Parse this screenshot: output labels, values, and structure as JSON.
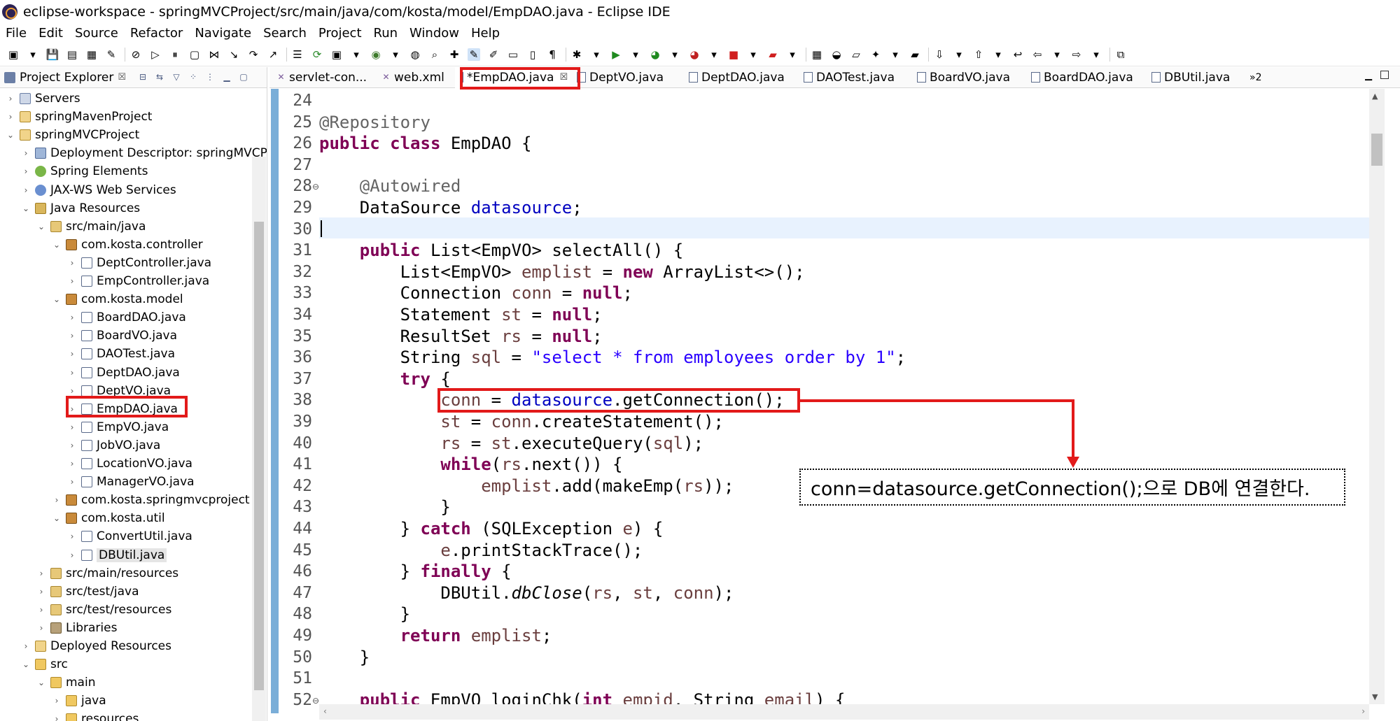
{
  "window": {
    "title": "eclipse-workspace - springMVCProject/src/main/java/com/kosta/model/EmpDAO.java - Eclipse IDE"
  },
  "menubar": [
    "File",
    "Edit",
    "Source",
    "Refactor",
    "Navigate",
    "Search",
    "Project",
    "Run",
    "Window",
    "Help"
  ],
  "explorer": {
    "title": "Project Explorer",
    "close": "☒",
    "tree": [
      {
        "label": "Servers",
        "depth": 0,
        "twisty": "›",
        "icon": "server"
      },
      {
        "label": "springMavenProject",
        "depth": 0,
        "twisty": "›",
        "icon": "proj"
      },
      {
        "label": "springMVCProject",
        "depth": 0,
        "twisty": "⌄",
        "icon": "proj"
      },
      {
        "label": "Deployment Descriptor: springMVCP",
        "depth": 1,
        "twisty": "›",
        "icon": "dd"
      },
      {
        "label": "Spring Elements",
        "depth": 1,
        "twisty": "›",
        "icon": "spring"
      },
      {
        "label": "JAX-WS Web Services",
        "depth": 1,
        "twisty": "›",
        "icon": "ws"
      },
      {
        "label": "Java Resources",
        "depth": 1,
        "twisty": "⌄",
        "icon": "jr"
      },
      {
        "label": "src/main/java",
        "depth": 2,
        "twisty": "⌄",
        "icon": "src"
      },
      {
        "label": "com.kosta.controller",
        "depth": 3,
        "twisty": "⌄",
        "icon": "pkg"
      },
      {
        "label": "DeptController.java",
        "depth": 4,
        "twisty": "›",
        "icon": "java"
      },
      {
        "label": "EmpController.java",
        "depth": 4,
        "twisty": "›",
        "icon": "java"
      },
      {
        "label": "com.kosta.model",
        "depth": 3,
        "twisty": "⌄",
        "icon": "pkg"
      },
      {
        "label": "BoardDAO.java",
        "depth": 4,
        "twisty": "›",
        "icon": "java"
      },
      {
        "label": "BoardVO.java",
        "depth": 4,
        "twisty": "›",
        "icon": "java"
      },
      {
        "label": "DAOTest.java",
        "depth": 4,
        "twisty": "›",
        "icon": "java"
      },
      {
        "label": "DeptDAO.java",
        "depth": 4,
        "twisty": "›",
        "icon": "java"
      },
      {
        "label": "DeptVO.java",
        "depth": 4,
        "twisty": "›",
        "icon": "java"
      },
      {
        "label": "EmpDAO.java",
        "depth": 4,
        "twisty": "›",
        "icon": "java"
      },
      {
        "label": "EmpVO.java",
        "depth": 4,
        "twisty": "›",
        "icon": "java"
      },
      {
        "label": "JobVO.java",
        "depth": 4,
        "twisty": "›",
        "icon": "java"
      },
      {
        "label": "LocationVO.java",
        "depth": 4,
        "twisty": "›",
        "icon": "java"
      },
      {
        "label": "ManagerVO.java",
        "depth": 4,
        "twisty": "›",
        "icon": "java"
      },
      {
        "label": "com.kosta.springmvcproject",
        "depth": 3,
        "twisty": "›",
        "icon": "pkg"
      },
      {
        "label": "com.kosta.util",
        "depth": 3,
        "twisty": "⌄",
        "icon": "pkg"
      },
      {
        "label": "ConvertUtil.java",
        "depth": 4,
        "twisty": "›",
        "icon": "java"
      },
      {
        "label": "DBUtil.java",
        "depth": 4,
        "twisty": "›",
        "icon": "java",
        "selected": true
      },
      {
        "label": "src/main/resources",
        "depth": 2,
        "twisty": "›",
        "icon": "src"
      },
      {
        "label": "src/test/java",
        "depth": 2,
        "twisty": "›",
        "icon": "src"
      },
      {
        "label": "src/test/resources",
        "depth": 2,
        "twisty": "›",
        "icon": "src"
      },
      {
        "label": "Libraries",
        "depth": 2,
        "twisty": "›",
        "icon": "lib"
      },
      {
        "label": "Deployed Resources",
        "depth": 1,
        "twisty": "›",
        "icon": "proj"
      },
      {
        "label": "src",
        "depth": 1,
        "twisty": "⌄",
        "icon": "folder"
      },
      {
        "label": "main",
        "depth": 2,
        "twisty": "⌄",
        "icon": "folder"
      },
      {
        "label": "java",
        "depth": 3,
        "twisty": "›",
        "icon": "folder"
      },
      {
        "label": "resources",
        "depth": 3,
        "twisty": "›",
        "icon": "folder"
      }
    ]
  },
  "tabs": [
    {
      "label": "servlet-con...",
      "icon": "xml"
    },
    {
      "label": "web.xml",
      "icon": "xml"
    },
    {
      "label": "*EmpDAO.java",
      "icon": "java",
      "active": true,
      "close": "☒"
    },
    {
      "label": "DeptVO.java",
      "icon": "java"
    },
    {
      "label": "DeptDAO.java",
      "icon": "java"
    },
    {
      "label": "DAOTest.java",
      "icon": "java"
    },
    {
      "label": "BoardVO.java",
      "icon": "java"
    },
    {
      "label": "BoardDAO.java",
      "icon": "java"
    },
    {
      "label": "DBUtil.java",
      "icon": "java"
    }
  ],
  "tabs_overflow": "»2",
  "editor": {
    "current_line": 30,
    "lines": [
      {
        "n": "24",
        "html": ""
      },
      {
        "n": "25",
        "html": "<span class=\"ann\">@Repository</span>"
      },
      {
        "n": "26",
        "html": "<span class=\"kw\">public class</span> EmpDAO {"
      },
      {
        "n": "27",
        "html": ""
      },
      {
        "n": "28",
        "fold": "⊖",
        "html": "    <span class=\"ann\">@Autowired</span>"
      },
      {
        "n": "29",
        "html": "    DataSource <span class=\"fld\">datasource</span>;"
      },
      {
        "n": "30",
        "html": ""
      },
      {
        "n": "31",
        "html": "    <span class=\"kw\">public</span> List&lt;EmpVO&gt; selectAll() {"
      },
      {
        "n": "32",
        "html": "        List&lt;EmpVO&gt; <span class=\"loc\">emplist</span> = <span class=\"kw\">new</span> ArrayList&lt;&gt;();"
      },
      {
        "n": "33",
        "html": "        Connection <span class=\"loc\">conn</span> = <span class=\"kw\">null</span>;"
      },
      {
        "n": "34",
        "html": "        Statement <span class=\"loc\">st</span> = <span class=\"kw\">null</span>;"
      },
      {
        "n": "35",
        "html": "        ResultSet <span class=\"loc\">rs</span> = <span class=\"kw\">null</span>;"
      },
      {
        "n": "36",
        "html": "        String <span class=\"loc\">sql</span> = <span class=\"str\">\"select * from employees order by 1\"</span>;"
      },
      {
        "n": "37",
        "html": "        <span class=\"kw\">try</span> {"
      },
      {
        "n": "38",
        "html": "            <span class=\"loc\">conn</span> = <span class=\"fld\">datasource</span>.getConnection();"
      },
      {
        "n": "39",
        "html": "            <span class=\"loc\">st</span> = <span class=\"loc\">conn</span>.createStatement();"
      },
      {
        "n": "40",
        "html": "            <span class=\"loc\">rs</span> = <span class=\"loc\">st</span>.executeQuery(<span class=\"loc\">sql</span>);"
      },
      {
        "n": "41",
        "html": "            <span class=\"kw\">while</span>(<span class=\"loc\">rs</span>.next()) {"
      },
      {
        "n": "42",
        "html": "                <span class=\"loc\">emplist</span>.add(makeEmp(<span class=\"loc\">rs</span>));"
      },
      {
        "n": "43",
        "html": "            }"
      },
      {
        "n": "44",
        "html": "        } <span class=\"kw\">catch</span> (SQLException <span class=\"loc\">e</span>) {"
      },
      {
        "n": "45",
        "html": "            <span class=\"loc\">e</span>.printStackTrace();"
      },
      {
        "n": "46",
        "html": "        } <span class=\"kw\">finally</span> {"
      },
      {
        "n": "47",
        "html": "            DBUtil.<span class=\"st\">dbClose</span>(<span class=\"loc\">rs</span>, <span class=\"loc\">st</span>, <span class=\"loc\">conn</span>);"
      },
      {
        "n": "48",
        "html": "        }"
      },
      {
        "n": "49",
        "html": "        <span class=\"kw\">return</span> <span class=\"loc\">emplist</span>;"
      },
      {
        "n": "50",
        "html": "    }"
      },
      {
        "n": "51",
        "html": ""
      },
      {
        "n": "52",
        "fold": "⊖",
        "html": "    <span class=\"kw\">public</span> EmpVO loginChk(<span class=\"kw\">int</span> <span class=\"loc\">empid</span>, String <span class=\"loc\">email</span>) {"
      }
    ]
  },
  "annotation": {
    "note": "conn=datasource.getConnection();으로 DB에 연결한다.",
    "color": "#e21a1a"
  },
  "colors": {
    "keyword": "#7f0055",
    "field": "#0000c0",
    "string": "#2a00ff",
    "annotation": "#646464",
    "current_line": "#e8f2fe",
    "ruler": "#7aaed8"
  }
}
